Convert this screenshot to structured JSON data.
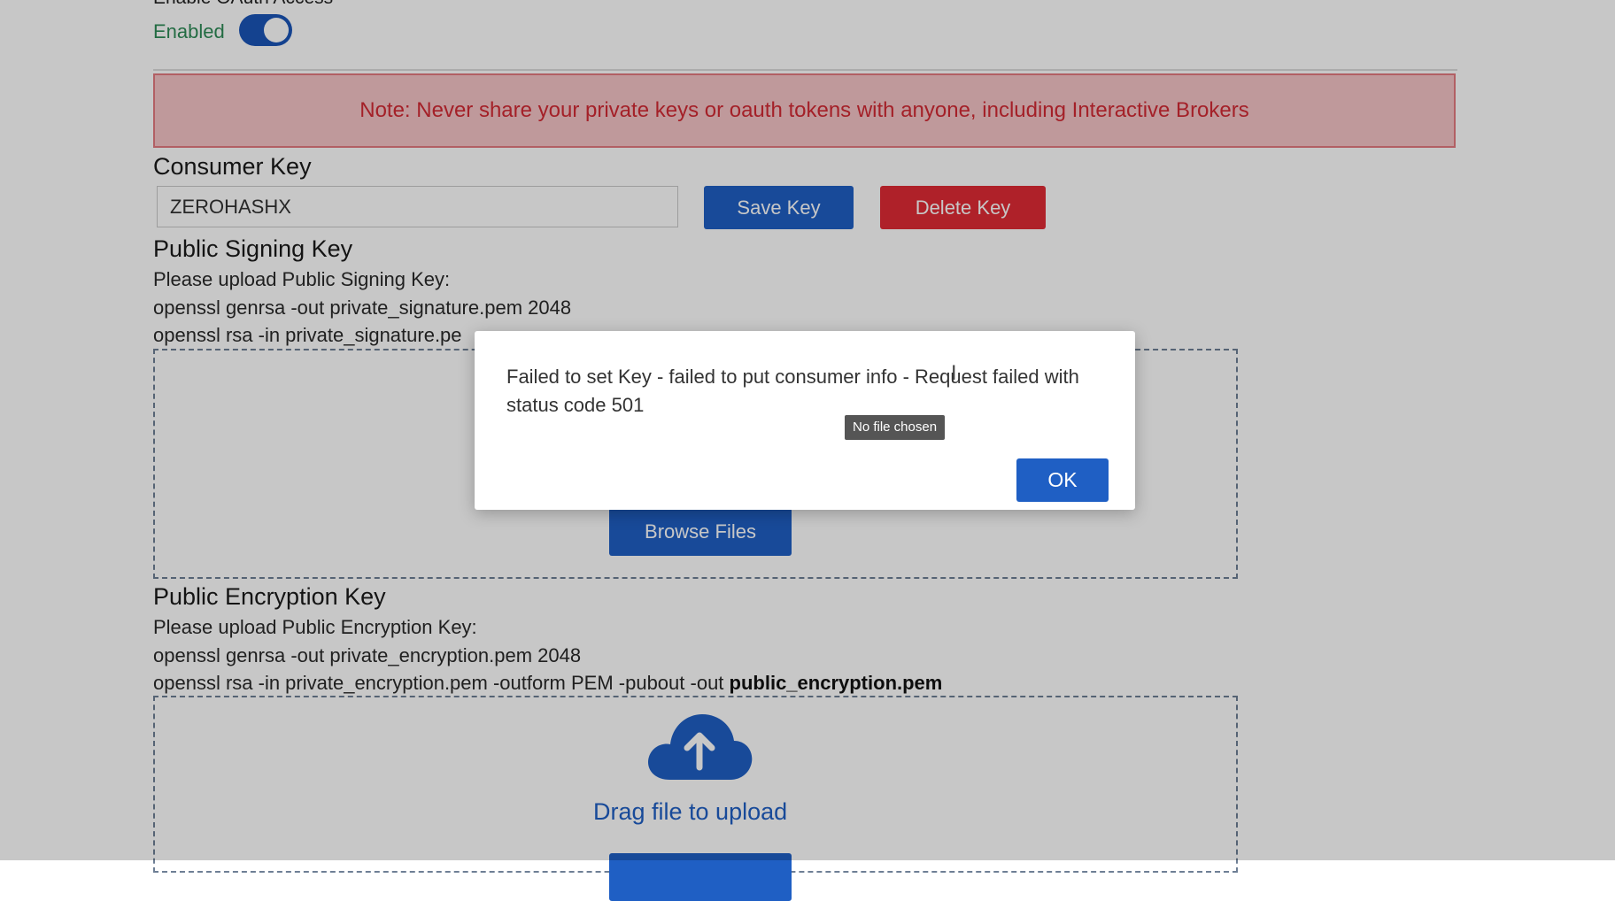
{
  "oauth": {
    "heading": "Enable OAuth Access",
    "status_label": "Enabled",
    "toggle_on": true
  },
  "note": {
    "text": "Note: Never share your private keys or oauth tokens with anyone, including Interactive Brokers"
  },
  "consumer_key": {
    "title": "Consumer Key",
    "value": "ZEROHASHX",
    "save_label": "Save Key",
    "delete_label": "Delete Key"
  },
  "signing": {
    "title": "Public Signing Key",
    "line1": "Please upload Public Signing Key:",
    "line2": "openssl genrsa -out private_signature.pem 2048",
    "line3": "openssl rsa -in private_signature.pe",
    "browse_label": "Browse Files"
  },
  "encryption": {
    "title": "Public Encryption Key",
    "line1": "Please upload Public Encryption Key:",
    "line2": "openssl genrsa -out private_encryption.pem 2048",
    "line3_prefix": "openssl rsa -in private_encryption.pem -outform PEM -pubout -out ",
    "line3_file": "public_encryption.pem",
    "drag_text": "Drag file to upload",
    "upload_icon": "cloud-upload-icon"
  },
  "dialog": {
    "message": "Failed to set Key - failed to put consumer info - Request failed with status code 501",
    "tooltip": "No file chosen",
    "ok_label": "OK"
  },
  "colors": {
    "primary": "#1f5fc4",
    "danger": "#e02b35",
    "note_bg": "#f5c5c7",
    "note_text": "#d22a34",
    "enabled_text": "#2e8b57"
  }
}
